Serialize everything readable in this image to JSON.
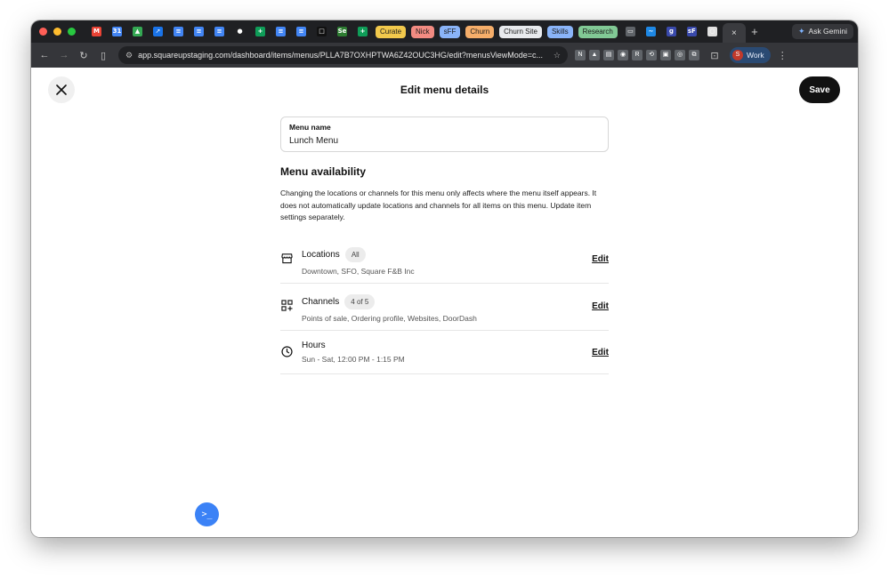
{
  "browser": {
    "tab_groups": [
      {
        "label": "Curate",
        "color": "#f2c94c"
      },
      {
        "label": "Nick",
        "color": "#f28b82"
      },
      {
        "label": "sFF",
        "color": "#8ab4f8"
      },
      {
        "label": "Churn",
        "color": "#f6ae6a"
      },
      {
        "label": "Churn Site",
        "color": "#e8eaed"
      },
      {
        "label": "Skills",
        "color": "#8ab4f8"
      },
      {
        "label": "Research",
        "color": "#81c995"
      }
    ],
    "favicons_left": [
      {
        "icon": "gmail-icon",
        "text": "M",
        "color": "#ea4335"
      },
      {
        "icon": "calendar-icon",
        "text": "31",
        "color": "#4285f4"
      },
      {
        "icon": "drive-icon",
        "text": "▲",
        "color": "#34a853"
      },
      {
        "icon": "rocket-icon",
        "text": "➚",
        "color": "#1a73e8"
      },
      {
        "icon": "docs-icon",
        "text": "≡",
        "color": "#4285f4"
      },
      {
        "icon": "docs-icon",
        "text": "≡",
        "color": "#4285f4"
      },
      {
        "icon": "docs-icon",
        "text": "≡",
        "color": "#4285f4"
      },
      {
        "icon": "github-icon",
        "text": "●",
        "color": "#202124"
      },
      {
        "icon": "sheets-icon",
        "text": "+",
        "color": "#0f9d58"
      },
      {
        "icon": "docs-icon",
        "text": "≡",
        "color": "#4285f4"
      },
      {
        "icon": "docs-icon",
        "text": "≡",
        "color": "#4285f4"
      },
      {
        "icon": "square-icon",
        "text": "□",
        "color": "#111111"
      },
      {
        "icon": "se-icon",
        "text": "Se",
        "color": "#2e7d32"
      },
      {
        "icon": "sheets-icon",
        "text": "+",
        "color": "#0f9d58"
      }
    ],
    "favicons_right": [
      {
        "icon": "printer-icon",
        "text": "▭",
        "color": "#5f6368"
      },
      {
        "icon": "wave-icon",
        "text": "~",
        "color": "#1e88e5"
      },
      {
        "icon": "g-icon",
        "text": "g",
        "color": "#3949ab"
      },
      {
        "icon": "sff-icon",
        "text": "sF",
        "color": "#3949ab"
      },
      {
        "icon": "circle-icon",
        "text": "○",
        "color": "#e0e0e0"
      }
    ],
    "active_tab_close": "×",
    "new_tab": "+",
    "ask_gemini": "Ask Gemini",
    "url": "app.squareupstaging.com/dashboard/items/menus/PLLA7B7OXHPTWA6Z42OUC3HG/edit?menusViewMode=c...",
    "profile_initial": "S",
    "profile_label": "Work",
    "extensions": [
      "N",
      "▲",
      "▤",
      "◉",
      "R",
      "⟲",
      "▣",
      "◎",
      "⧉"
    ]
  },
  "page": {
    "title": "Edit menu details",
    "save_label": "Save",
    "menu_name_label": "Menu name",
    "menu_name_value": "Lunch Menu",
    "availability_title": "Menu availability",
    "availability_desc": "Changing the locations or channels for this menu only affects where the menu itself appears. It does not automatically update locations and channels for all items on this menu. Update item settings separately.",
    "rows": [
      {
        "icon": "store-icon",
        "title": "Locations",
        "pill": "All",
        "sub": "Downtown, SFO, Square F&B Inc",
        "edit": "Edit"
      },
      {
        "icon": "grid-plus-icon",
        "title": "Channels",
        "pill": "4 of 5",
        "sub": "Points of sale, Ordering profile, Websites, DoorDash",
        "edit": "Edit"
      },
      {
        "icon": "clock-icon",
        "title": "Hours",
        "pill": "",
        "sub": "Sun - Sat, 12:00 PM - 1:15 PM",
        "edit": "Edit"
      }
    ],
    "fab_symbol": ">_"
  }
}
